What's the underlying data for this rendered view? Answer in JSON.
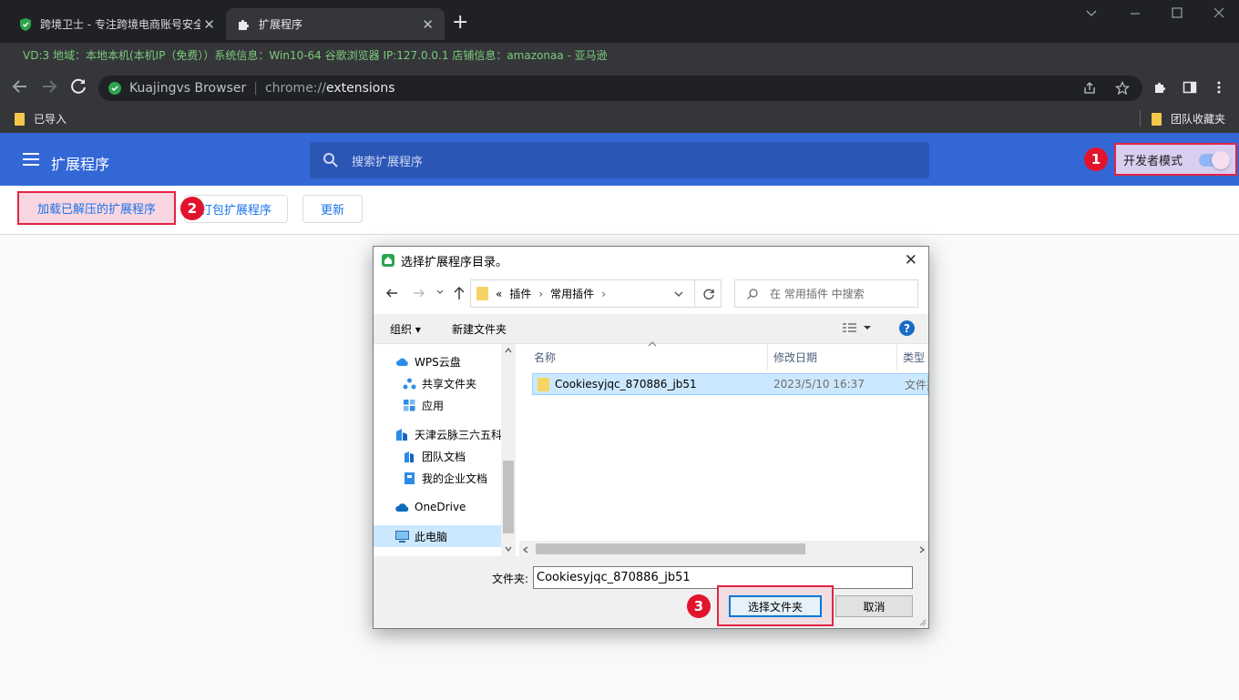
{
  "browser": {
    "tabs": [
      {
        "title": "跨境卫士 - 专注跨境电商账号安全",
        "close": "✕",
        "active": false
      },
      {
        "title": "扩展程序",
        "close": "✕",
        "active": true
      }
    ],
    "new_tab": "+",
    "info_bar": "VD:3 地域：本地本机(本机IP（免费））系统信息：Win10-64 谷歌浏览器 IP:127.0.0.1 店铺信息：amazonaa - 亚马逊",
    "omnibox": {
      "site": "Kuajingvs Browser",
      "url_scheme": "chrome://",
      "url_path": "extensions"
    },
    "bookmarks": [
      {
        "label": "已导入"
      },
      {
        "label": "团队收藏夹"
      }
    ],
    "accent_color": "#3367d6"
  },
  "extensions": {
    "title": "扩展程序",
    "search_placeholder": "搜索扩展程序",
    "developer_mode_label": "开发者模式",
    "developer_mode_on": true,
    "buttons": {
      "load_unpacked": "加载已解压的扩展程序",
      "pack": "打包扩展程序",
      "update": "更新"
    }
  },
  "annotations": [
    "1",
    "2",
    "3"
  ],
  "dialog": {
    "title": "选择扩展程序目录。",
    "close": "✕",
    "path": {
      "prefix": "«",
      "segments": [
        "插件",
        "常用插件"
      ]
    },
    "search_placeholder": "在 常用插件 中搜索",
    "organize": "组织 ▾",
    "new_folder": "新建文件夹",
    "help": "?",
    "nav_items": [
      {
        "label": "WPS云盘",
        "icon": "cloud-icon"
      },
      {
        "label": "共享文件夹",
        "icon": "share-icon"
      },
      {
        "label": "应用",
        "icon": "apps-icon"
      },
      {
        "label": "天津云脉三六五科",
        "icon": "building-icon"
      },
      {
        "label": "团队文档",
        "icon": "team-doc-icon"
      },
      {
        "label": "我的企业文档",
        "icon": "doc-icon"
      },
      {
        "label": "OneDrive",
        "icon": "onedrive-icon"
      },
      {
        "label": "此电脑",
        "icon": "computer-icon"
      }
    ],
    "columns": [
      "名称",
      "修改日期",
      "类型"
    ],
    "files": [
      {
        "name": "Cookiesyjqc_870886_jb51",
        "modified": "2023/5/10 16:37",
        "type": "文件夹"
      }
    ],
    "folder_label": "文件夹:",
    "folder_value": "Cookiesyjqc_870886_jb51",
    "select_button": "选择文件夹",
    "cancel_button": "取消"
  }
}
